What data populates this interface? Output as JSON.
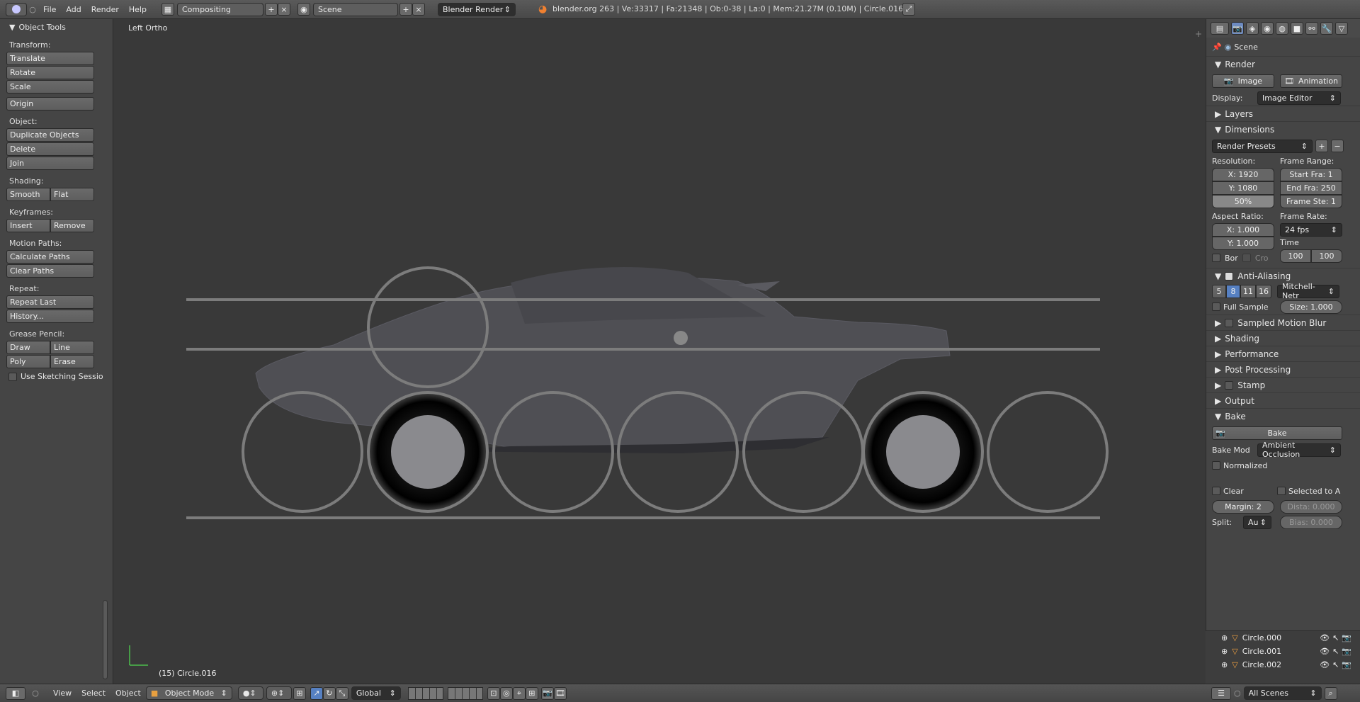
{
  "topbar": {
    "menus": [
      "File",
      "Add",
      "Render",
      "Help"
    ],
    "layout": "Compositing",
    "scene": "Scene",
    "engine": "Blender Render",
    "status": "blender.org 263 | Ve:33317 | Fa:21348 | Ob:0-38 | La:0 | Mem:21.27M (0.10M) | Circle.016"
  },
  "tools": {
    "title": "Object Tools",
    "transform_label": "Transform:",
    "translate": "Translate",
    "rotate": "Rotate",
    "scale": "Scale",
    "origin": "Origin",
    "object_label": "Object:",
    "duplicate": "Duplicate Objects",
    "delete": "Delete",
    "join": "Join",
    "shading_label": "Shading:",
    "smooth": "Smooth",
    "flat": "Flat",
    "keyframes_label": "Keyframes:",
    "insert": "Insert",
    "remove": "Remove",
    "motion_label": "Motion Paths:",
    "calc_paths": "Calculate Paths",
    "clear_paths": "Clear Paths",
    "repeat_label": "Repeat:",
    "repeat_last": "Repeat Last",
    "history": "History...",
    "grease_label": "Grease Pencil:",
    "draw": "Draw",
    "line": "Line",
    "poly": "Poly",
    "erase": "Erase",
    "sketch": "Use Sketching Sessio"
  },
  "viewport": {
    "view_name": "Left Ortho",
    "object_info": "(15) Circle.016"
  },
  "properties": {
    "scene": "Scene",
    "render": "Render",
    "image": "Image",
    "animation": "Animation",
    "display_label": "Display:",
    "display_value": "Image Editor",
    "layers": "Layers",
    "dimensions": "Dimensions",
    "presets": "Render Presets",
    "resolution_label": "Resolution:",
    "res_x": "X: 1920",
    "res_y": "Y: 1080",
    "res_pct": "50%",
    "frame_range_label": "Frame Range:",
    "start": "Start Fra: 1",
    "end": "End Fra: 250",
    "step": "Frame Ste: 1",
    "aspect_label": "Aspect Ratio:",
    "aspect_x": "X: 1.000",
    "aspect_y": "Y: 1.000",
    "frame_rate_label": "Frame Rate:",
    "fps": "24 fps",
    "time_remap_label": "Time Remapping",
    "remap_old": "100",
    "remap_new": "100",
    "bor": "Bor",
    "cro": "Cro",
    "antialiasing": "Anti-Aliasing",
    "aa_samples": [
      "5",
      "8",
      "11",
      "16"
    ],
    "aa_filter": "Mitchell-Netr",
    "full_sample": "Full Sample",
    "size": "Size: 1.000",
    "motion_blur": "Sampled Motion Blur",
    "shading": "Shading",
    "performance": "Performance",
    "post": "Post Processing",
    "stamp": "Stamp",
    "output": "Output",
    "bake": "Bake",
    "bake_button": "Bake",
    "bake_mode_label": "Bake Mod",
    "bake_mode": "Ambient Occlusion",
    "normalized": "Normalized",
    "clear": "Clear",
    "selected_to_active": "Selected to A",
    "margin": "Margin: 2",
    "distance": "Dista: 0.000",
    "split_label": "Split:",
    "split_value": "Au",
    "bias": "Bias: 0.000"
  },
  "outliner": {
    "items": [
      "Circle.000",
      "Circle.001",
      "Circle.002"
    ],
    "filter": "All Scenes"
  },
  "bottombar": {
    "menus": [
      "View",
      "Select",
      "Object"
    ],
    "mode": "Object Mode",
    "orientation": "Global"
  }
}
